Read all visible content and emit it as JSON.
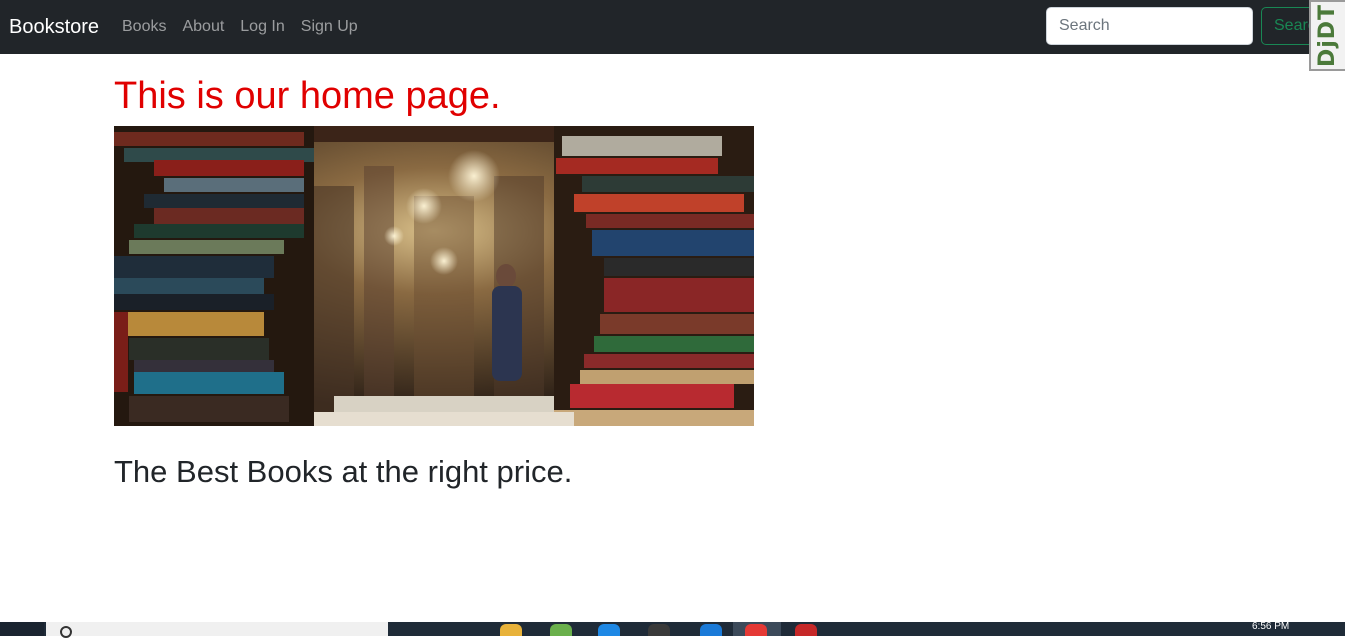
{
  "navbar": {
    "brand": "Bookstore",
    "links": [
      "Books",
      "About",
      "Log In",
      "Sign Up"
    ],
    "search_placeholder": "Search",
    "search_button": "Search"
  },
  "debug_toolbar": {
    "label": "DjDT"
  },
  "main": {
    "title": "This is our home page.",
    "tagline": "The Best Books at the right price."
  },
  "taskbar": {
    "clock": "6:56 PM"
  },
  "colors": {
    "navbar_bg": "#212529",
    "title_red": "#e00000",
    "search_green": "#198754"
  }
}
